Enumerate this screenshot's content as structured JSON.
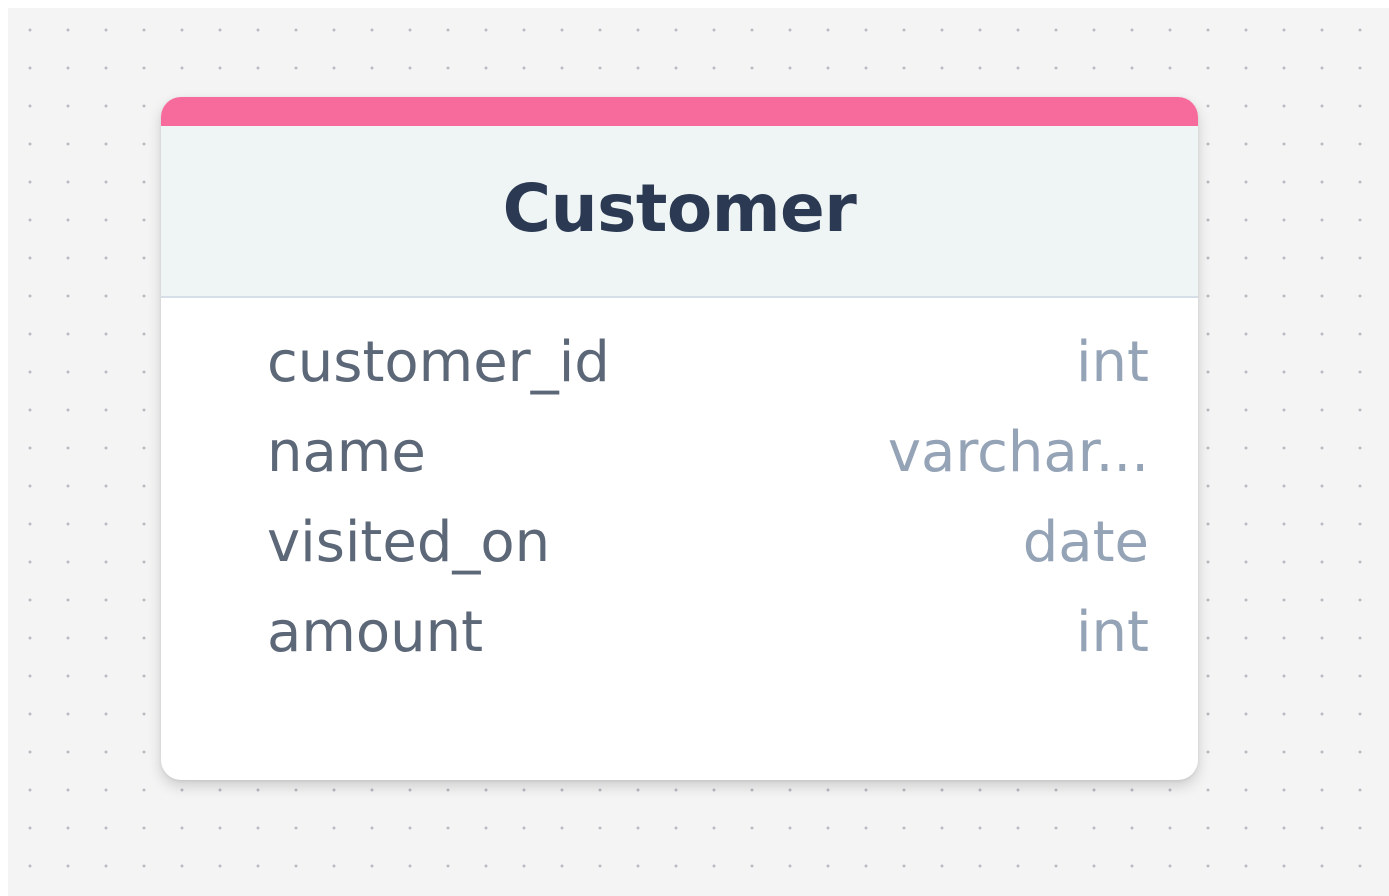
{
  "colors": {
    "accent": "#f76b9c",
    "canvas_background": "#f4f4f4",
    "header_background": "#eff4f5",
    "title_text": "#2b3a52",
    "column_name_text": "#5c6778",
    "column_type_text": "#95a3b7"
  },
  "table": {
    "title": "Customer",
    "columns": [
      {
        "name": "customer_id",
        "type": "int"
      },
      {
        "name": "name",
        "type": "varchar..."
      },
      {
        "name": "visited_on",
        "type": "date"
      },
      {
        "name": "amount",
        "type": "int"
      }
    ]
  }
}
